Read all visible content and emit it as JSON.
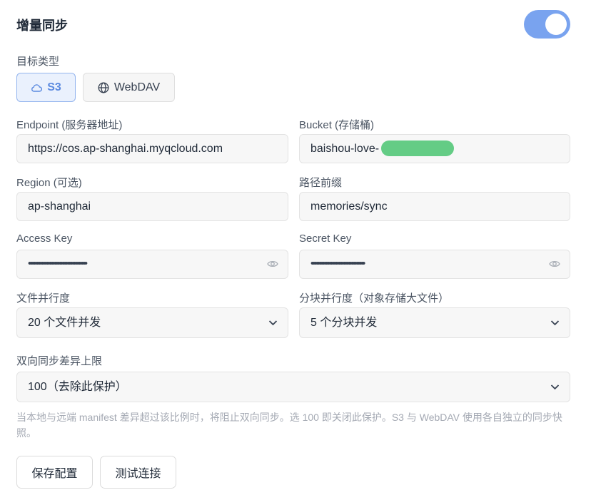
{
  "header": {
    "title": "增量同步",
    "toggle_on": true
  },
  "target_type": {
    "label": "目标类型",
    "options": [
      {
        "label": "S3",
        "icon": "cloud-icon",
        "selected": true
      },
      {
        "label": "WebDAV",
        "icon": "globe-icon",
        "selected": false
      }
    ]
  },
  "endpoint": {
    "label": "Endpoint (服务器地址)",
    "value": "https://cos.ap-shanghai.myqcloud.com"
  },
  "bucket": {
    "label": "Bucket (存储桶)",
    "value": "baishou-love-"
  },
  "region": {
    "label": "Region (可选)",
    "value": "ap-shanghai"
  },
  "prefix": {
    "label": "路径前缀",
    "value": "memories/sync"
  },
  "access_key": {
    "label": "Access Key",
    "masked": "••••••••••••••••••••••••••••••••••••"
  },
  "secret_key": {
    "label": "Secret Key",
    "masked": "•••••••••••••••••••••••••••••••••"
  },
  "file_concurrency": {
    "label": "文件并行度",
    "selected": "20 个文件并发"
  },
  "chunk_concurrency": {
    "label": "分块并行度（对象存储大文件）",
    "selected": "5 个分块并发"
  },
  "diff_limit": {
    "label": "双向同步差异上限",
    "selected": "100（去除此保护）",
    "hint": "当本地与远端 manifest 差异超过该比例时，将阻止双向同步。选 100 即关闭此保护。S3 与 WebDAV 使用各自独立的同步快照。"
  },
  "actions": {
    "save_label": "保存配置",
    "test_label": "测试连接"
  }
}
